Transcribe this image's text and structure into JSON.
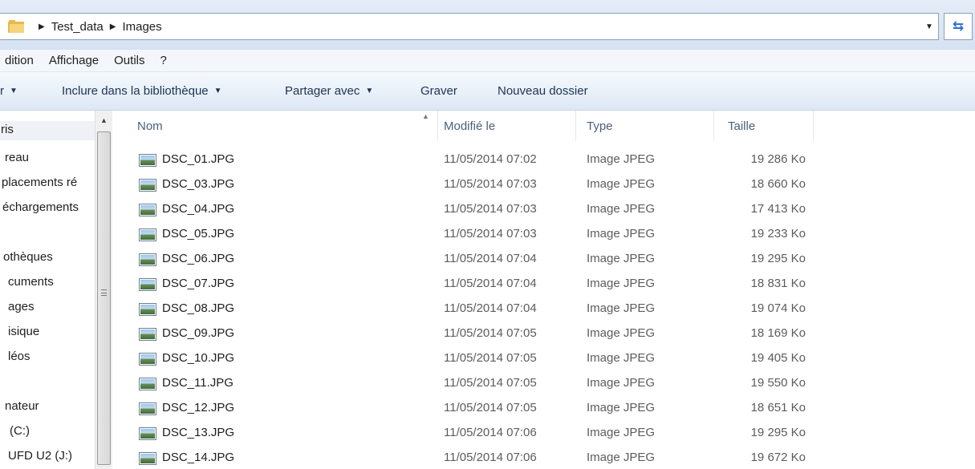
{
  "address": {
    "breadcrumb": [
      "Test_data",
      "Images"
    ]
  },
  "menu": [
    "dition",
    "Affichage",
    "Outils",
    "?"
  ],
  "toolbar": {
    "organize_partial": "r",
    "include_library": "Inclure dans la bibliothèque",
    "share_with": "Partager avec",
    "burn": "Graver",
    "new_folder": "Nouveau dossier"
  },
  "nav": {
    "items": [
      {
        "label": "ris"
      },
      {
        "label": "reau"
      },
      {
        "label": "placements ré"
      },
      {
        "label": "échargements"
      },
      {
        "label": ""
      },
      {
        "label": "othèques"
      },
      {
        "label": "cuments"
      },
      {
        "label": "ages"
      },
      {
        "label": "isique"
      },
      {
        "label": "léos"
      },
      {
        "label": ""
      },
      {
        "label": "nateur"
      },
      {
        "label": "(C:)"
      },
      {
        "label": "UFD U2 (J:)"
      }
    ]
  },
  "columns": {
    "name": "Nom",
    "modified": "Modifié le",
    "type": "Type",
    "size": "Taille"
  },
  "files": [
    {
      "name": "DSC_01.JPG",
      "modified": "11/05/2014 07:02",
      "type": "Image JPEG",
      "size": "19 286 Ko"
    },
    {
      "name": "DSC_03.JPG",
      "modified": "11/05/2014 07:03",
      "type": "Image JPEG",
      "size": "18 660 Ko"
    },
    {
      "name": "DSC_04.JPG",
      "modified": "11/05/2014 07:03",
      "type": "Image JPEG",
      "size": "17 413 Ko"
    },
    {
      "name": "DSC_05.JPG",
      "modified": "11/05/2014 07:03",
      "type": "Image JPEG",
      "size": "19 233 Ko"
    },
    {
      "name": "DSC_06.JPG",
      "modified": "11/05/2014 07:04",
      "type": "Image JPEG",
      "size": "19 295 Ko"
    },
    {
      "name": "DSC_07.JPG",
      "modified": "11/05/2014 07:04",
      "type": "Image JPEG",
      "size": "18 831 Ko"
    },
    {
      "name": "DSC_08.JPG",
      "modified": "11/05/2014 07:04",
      "type": "Image JPEG",
      "size": "19 074 Ko"
    },
    {
      "name": "DSC_09.JPG",
      "modified": "11/05/2014 07:05",
      "type": "Image JPEG",
      "size": "18 169 Ko"
    },
    {
      "name": "DSC_10.JPG",
      "modified": "11/05/2014 07:05",
      "type": "Image JPEG",
      "size": "19 405 Ko"
    },
    {
      "name": "DSC_11.JPG",
      "modified": "11/05/2014 07:05",
      "type": "Image JPEG",
      "size": "19 550 Ko"
    },
    {
      "name": "DSC_12.JPG",
      "modified": "11/05/2014 07:05",
      "type": "Image JPEG",
      "size": "18 651 Ko"
    },
    {
      "name": "DSC_13.JPG",
      "modified": "11/05/2014 07:06",
      "type": "Image JPEG",
      "size": "19 295 Ko"
    },
    {
      "name": "DSC_14.JPG",
      "modified": "11/05/2014 07:06",
      "type": "Image JPEG",
      "size": "19 672 Ko"
    }
  ],
  "icons": {
    "folder": "folder-icon",
    "file": "jpeg-image-icon",
    "refresh": "refresh-icon"
  },
  "colors": {
    "toolbar_text": "#1e3354",
    "header_text": "#4c607a",
    "refresh_accent": "#2a6fd0"
  }
}
